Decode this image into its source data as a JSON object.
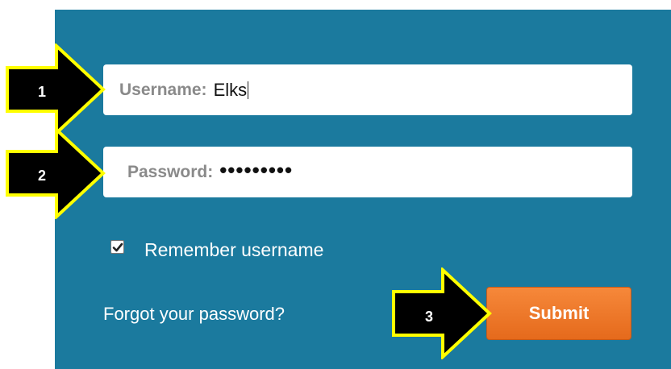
{
  "form": {
    "username_label": "Username:",
    "username_value": "Elks",
    "password_label": "Password:",
    "password_value": "•••••••••",
    "remember_label": "Remember username",
    "remember_checked": true,
    "forgot_link": "Forgot your password?",
    "submit_label": "Submit"
  },
  "annotations": {
    "step1": "1",
    "step2": "2",
    "step3": "3"
  },
  "colors": {
    "panel": "#1b7a9e",
    "submit": "#ef7a2a",
    "annotation_fill": "#000000",
    "annotation_border": "#ffff00"
  }
}
